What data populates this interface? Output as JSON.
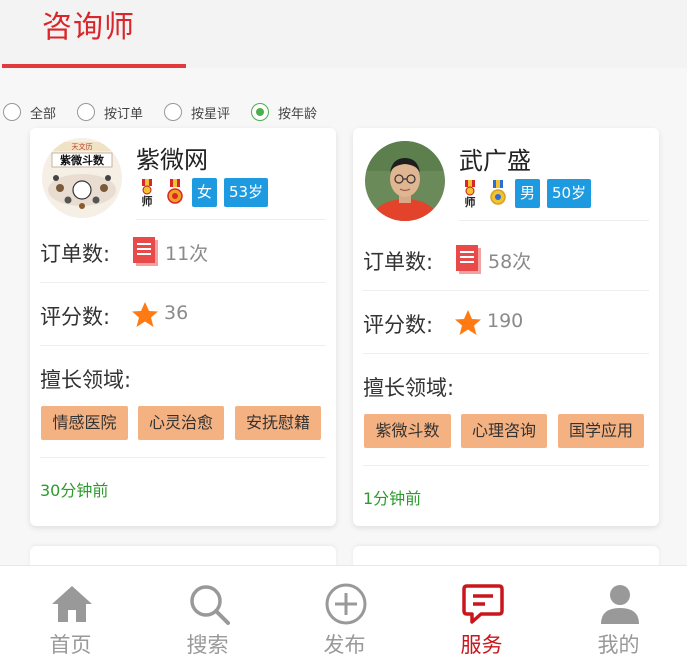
{
  "header": {
    "title": "咨询师"
  },
  "filters": [
    {
      "label": "全部",
      "checked": false
    },
    {
      "label": "按订单",
      "checked": false
    },
    {
      "label": "按星评",
      "checked": false
    },
    {
      "label": "按年龄",
      "checked": true
    }
  ],
  "cards": [
    {
      "name": "紫微网",
      "avatar_text": "紫微斗数",
      "avatar_caption": "天文历",
      "gender": "女",
      "age": "53岁",
      "orders_label": "订单数:",
      "orders_value": "11次",
      "rating_label": "评分数:",
      "rating_value": "36",
      "skills_label": "擅长领域:",
      "skills": [
        "情感医院",
        "心灵治愈",
        "安抚慰籍"
      ],
      "time": "30分钟前"
    },
    {
      "name": "武广盛",
      "gender": "男",
      "age": "50岁",
      "orders_label": "订单数:",
      "orders_value": "58次",
      "rating_label": "评分数:",
      "rating_value": "190",
      "skills_label": "擅长领域:",
      "skills": [
        "紫微斗数",
        "心理咨询",
        "国学应用"
      ],
      "time": "1分钟前"
    }
  ],
  "medal_text": "师",
  "tabbar": [
    {
      "label": "首页",
      "icon": "home-icon",
      "active": false
    },
    {
      "label": "搜索",
      "icon": "search-icon",
      "active": false
    },
    {
      "label": "发布",
      "icon": "add-circle-icon",
      "active": false
    },
    {
      "label": "服务",
      "icon": "message-icon",
      "active": true
    },
    {
      "label": "我的",
      "icon": "user-icon",
      "active": false
    }
  ],
  "colors": {
    "brand_red": "#d9262a",
    "active_green": "#4caf50",
    "tag_blue": "#1e9be0",
    "skill_tag": "#f4b182",
    "time_green": "#2d9a2d",
    "tab_inactive": "#999999",
    "tab_active": "#c9161c"
  }
}
